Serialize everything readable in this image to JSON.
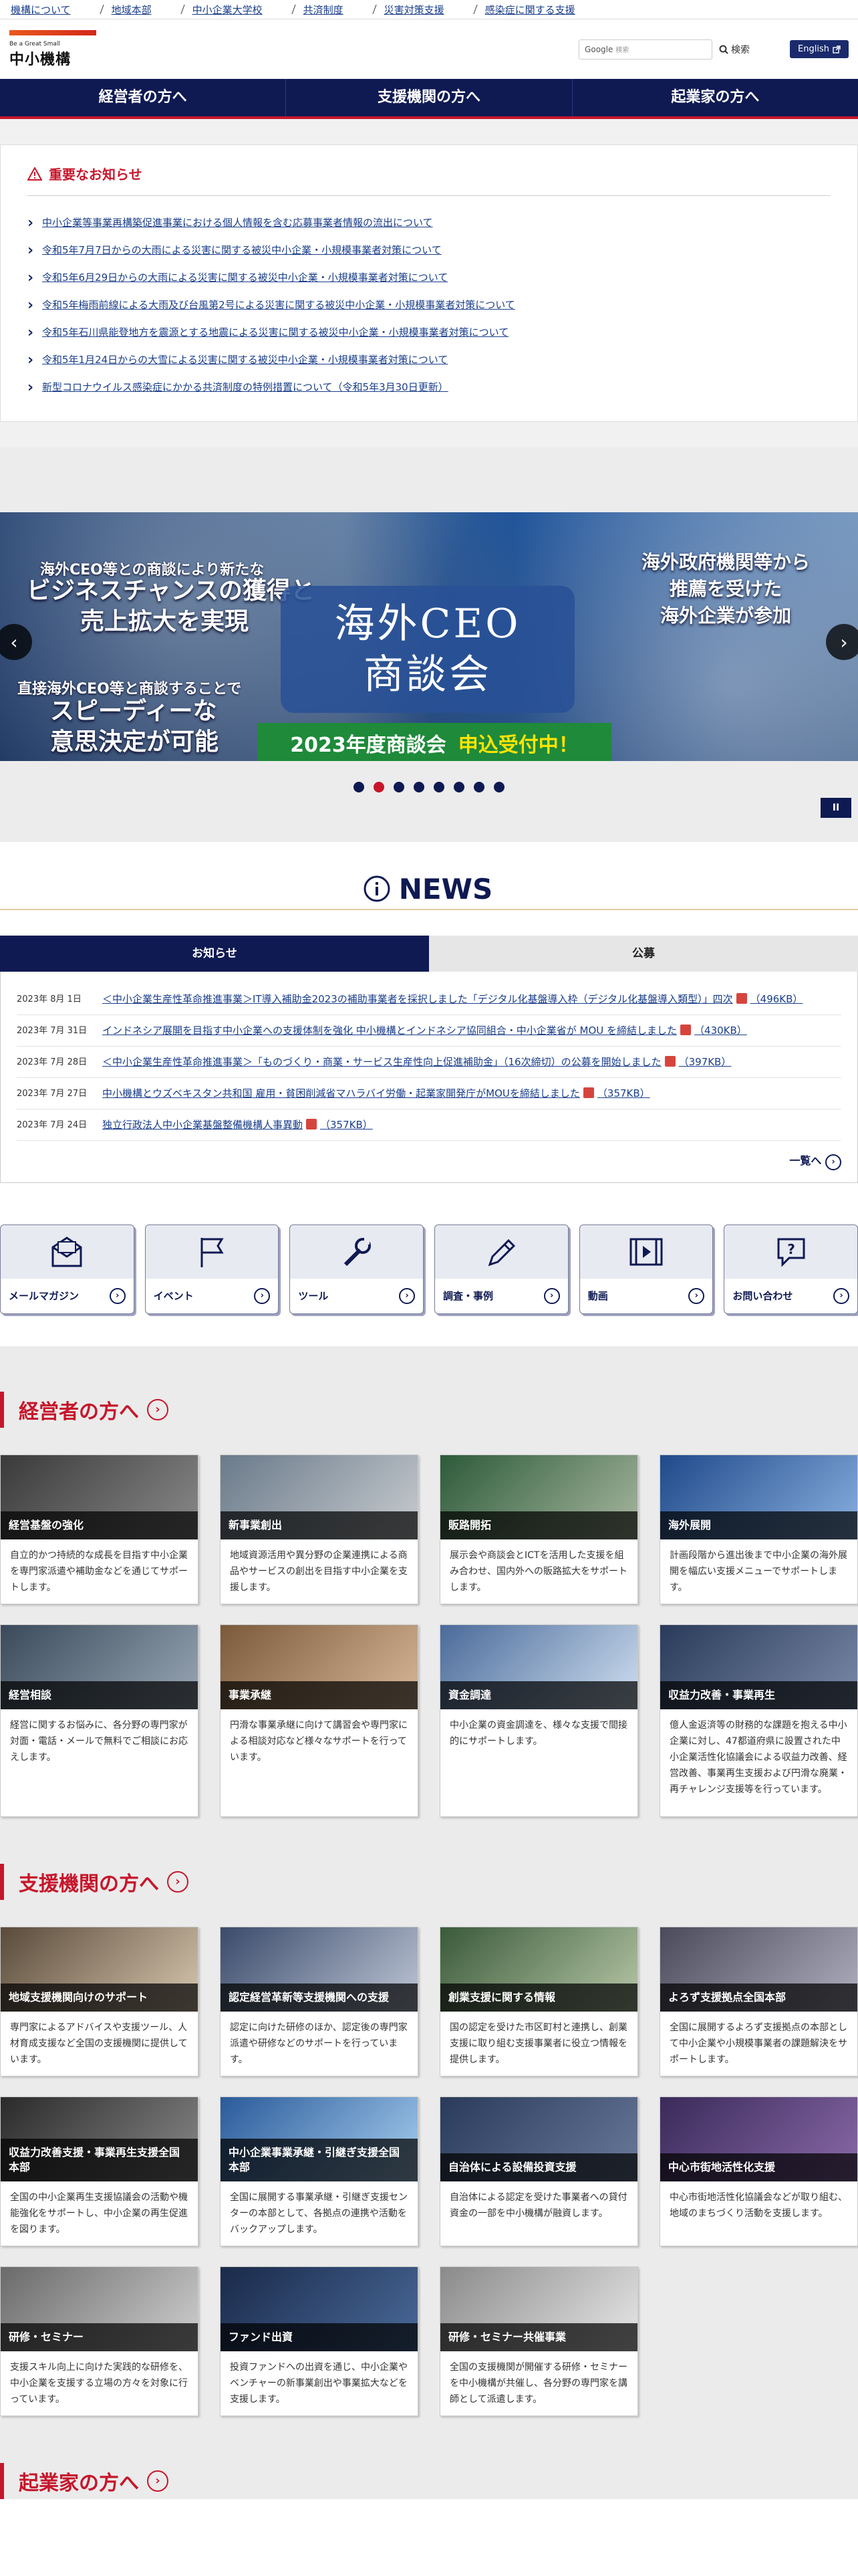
{
  "topnav": [
    "機構について",
    "地域本部",
    "中小企業大学校",
    "共済制度",
    "災害対策支援",
    "感染症に関する支援"
  ],
  "header": {
    "logo_tagline": "Be a Great Small",
    "logo_name": "中小機構",
    "search_brand": "Google",
    "search_placeholder": "検索",
    "search_button": "検索",
    "english_label": "English"
  },
  "gnav": [
    "経営者の方へ",
    "支援機関の方へ",
    "起業家の方へ"
  ],
  "notice": {
    "title": "重要なお知らせ",
    "items": [
      "中小企業等事業再構築促進事業における個人情報を含む応募事業者情報の流出について",
      "令和5年7月7日からの大雨による災害に関する被災中小企業・小規模事業者対策について",
      "令和5年6月29日からの大雨による災害に関する被災中小企業・小規模事業者対策について",
      "令和5年梅雨前線による大雨及び台風第2号による災害に関する被災中小企業・小規模事業者対策について",
      "令和5年石川県能登地方を震源とする地震による災害に関する被災中小企業・小規模事業者対策について",
      "令和5年1月24日からの大雪による災害に関する被災中小企業・小規模事業者対策について",
      "新型コロナウイルス感染症にかかる共済制度の特例措置について（令和5年3月30日更新）"
    ]
  },
  "banner": {
    "l1": "海外CEO等との商談により新たな",
    "l2a": "ビジネスチャンスの獲得と",
    "l2b": "売上拡大を実現",
    "l3": "直接海外CEO等と商談することで",
    "l4a": "スピーディーな",
    "l4b": "意思決定が可能",
    "center_a": "海外CEO",
    "center_b": "商談会",
    "cta_year": "2023年度商談会",
    "cta_hl": "申込受付中！",
    "r1": "海外政府機関等から",
    "r2": "推薦を受けた",
    "r3": "海外企業が参加",
    "pause": "II"
  },
  "news": {
    "title": "NEWS",
    "tabs": [
      "お知らせ",
      "公募"
    ],
    "items": [
      {
        "date": "2023年 8月 1日",
        "text": "＜中小企業生産性革命推進事業＞IT導入補助金2023の補助事業者を採択しました「デジタル化基盤導入枠（デジタル化基盤導入類型）」四次",
        "size": "（496KB）"
      },
      {
        "date": "2023年 7月 31日",
        "text": "インドネシア展開を目指す中小企業への支援体制を強化 中小機構とインドネシア協同組合・中小企業省が MOU を締結しました",
        "size": "（430KB）"
      },
      {
        "date": "2023年 7月 28日",
        "text": "＜中小企業生産性革命推進事業＞「ものづくり・商業・サービス生産性向上促進補助金」（16次締切）の公募を開始しました",
        "size": "（397KB）"
      },
      {
        "date": "2023年 7月 27日",
        "text": "中小機構とウズベキスタン共和国 雇用・貧困削減省マハラバイ労働・起業家開発庁がMOUを締結しました",
        "size": "（357KB）"
      },
      {
        "date": "2023年 7月 24日",
        "text": "独立行政法人中小企業基盤整備機構人事異動",
        "size": "（357KB）"
      }
    ],
    "more": "一覧へ"
  },
  "shortcuts": [
    "メールマガジン",
    "イベント",
    "ツール",
    "調査・事例",
    "動画",
    "お問い合わせ"
  ],
  "section1": {
    "title": "経営者の方へ",
    "cards": [
      {
        "cap": "経営基盤の強化",
        "desc": "自立的かつ持続的な成長を目指す中小企業を専門家派遣や補助金などを通じてサポートします。",
        "c1": "#3a3a3a",
        "c2": "#8a8a8a"
      },
      {
        "cap": "新事業創出",
        "desc": "地域資源活用や異分野の企業連携による商品やサービスの創出を目指す中小企業を支援します。",
        "c1": "#6a7a8a",
        "c2": "#c8ccd0"
      },
      {
        "cap": "販路開拓",
        "desc": "展示会や商談会とICTを活用した支援を組み合わせ、国内外への販路拡大をサポートします。",
        "c1": "#2d5a3a",
        "c2": "#a8b8a0"
      },
      {
        "cap": "海外展開",
        "desc": "計画段階から進出後まで中小企業の海外展開を幅広い支援メニューでサポートします。",
        "c1": "#1f4a8a",
        "c2": "#8ab0e0"
      },
      {
        "cap": "経営相談",
        "desc": "経営に関するお悩みに、各分野の専門家が対面・電話・メールで無料でご相談にお応えします。",
        "c1": "#3a4a5a",
        "c2": "#9aa8b6"
      },
      {
        "cap": "事業承継",
        "desc": "円滑な事業承継に向けて講習会や専門家による相談対応など様々なサポートを行っています。",
        "c1": "#7a5a3a",
        "c2": "#d8b898"
      },
      {
        "cap": "資金調達",
        "desc": "中小企業の資金調達を、様々な支援で間接的にサポートします。",
        "c1": "#4a6a9a",
        "c2": "#d0e0f0"
      },
      {
        "cap": "収益力改善・事業再生",
        "desc": "億人金返済等の財務的な課題を抱える中小企業に対し、47都道府県に設置された中小企業活性化協議会による収益力改善、経営改善、事業再生支援および円滑な廃業・再チャレンジ支援等を行っています。",
        "c1": "#2a3a5a",
        "c2": "#7a8aa8"
      }
    ]
  },
  "section2": {
    "title": "支援機関の方へ",
    "cards": [
      {
        "cap": "地域支援機関向けのサポート",
        "desc": "専門家によるアドバイスや支援ツール、人材育成支援など全国の支援機関に提供しています。",
        "c1": "#5a4a3a",
        "c2": "#d8c8b0"
      },
      {
        "cap": "認定経営革新等支援機関への支援",
        "desc": "認定に向けた研修のほか、認定後の専門家派遣や研修などのサポートを行っています。",
        "c1": "#3a4a6a",
        "c2": "#c0c8d8"
      },
      {
        "cap": "創業支援に関する情報",
        "desc": "国の認定を受けた市区町村と連携し、創業支援に取り組む支援事業者に役立つ情報を提供します。",
        "c1": "#3a5a3a",
        "c2": "#b8c8a8"
      },
      {
        "cap": "よろず支援拠点全国本部",
        "desc": "全国に展開するよろず支援拠点の本部として中小企業や小規模事業者の課題解決をサポートします。",
        "c1": "#4a4a5a",
        "c2": "#b0b0c0"
      },
      {
        "cap": "収益力改善支援・事業再生支援全国本部",
        "desc": "全国の中小企業再生支援協議会の活動や機能強化をサポートし、中小企業の再生促進を図ります。",
        "c1": "#2a2a2a",
        "c2": "#8a8a8a"
      },
      {
        "cap": "中小企業事業承継・引継ぎ支援全国本部",
        "desc": "全国に展開する事業承継・引継ぎ支援センターの本部として、各拠点の連携や活動をバックアップします。",
        "c1": "#2a5a9a",
        "c2": "#a8d0f0"
      },
      {
        "cap": "自治体による設備投資支援",
        "desc": "自治体による認定を受けた事業者への貸付資金の一部を中小機構が融資します。",
        "c1": "#2a3a5a",
        "c2": "#6a7a9a"
      },
      {
        "cap": "中心市街地活性化支援",
        "desc": "中心市街地活性化協議会などが取り組む、地域のまちづくり活動を支援します。",
        "c1": "#3a2a5a",
        "c2": "#8a6aa8"
      },
      {
        "cap": "研修・セミナー",
        "desc": "支援スキル向上に向けた実践的な研修を、中小企業を支援する立場の方々を対象に行っています。",
        "c1": "#6a6a6a",
        "c2": "#d0d0d0"
      },
      {
        "cap": "ファンド出資",
        "desc": "投資ファンドへの出資を通じ、中小企業やベンチャーの新事業創出や事業拡大などを支援します。",
        "c1": "#1a2a4a",
        "c2": "#4a6a9a"
      },
      {
        "cap": "研修・セミナー共催事業",
        "desc": "全国の支援機関が開催する研修・セミナーを中小機構が共催し、各分野の専門家を講師として派遣します。",
        "c1": "#8a8a8a",
        "c2": "#e8e8e8"
      }
    ]
  },
  "section3": {
    "title": "起業家の方へ"
  }
}
